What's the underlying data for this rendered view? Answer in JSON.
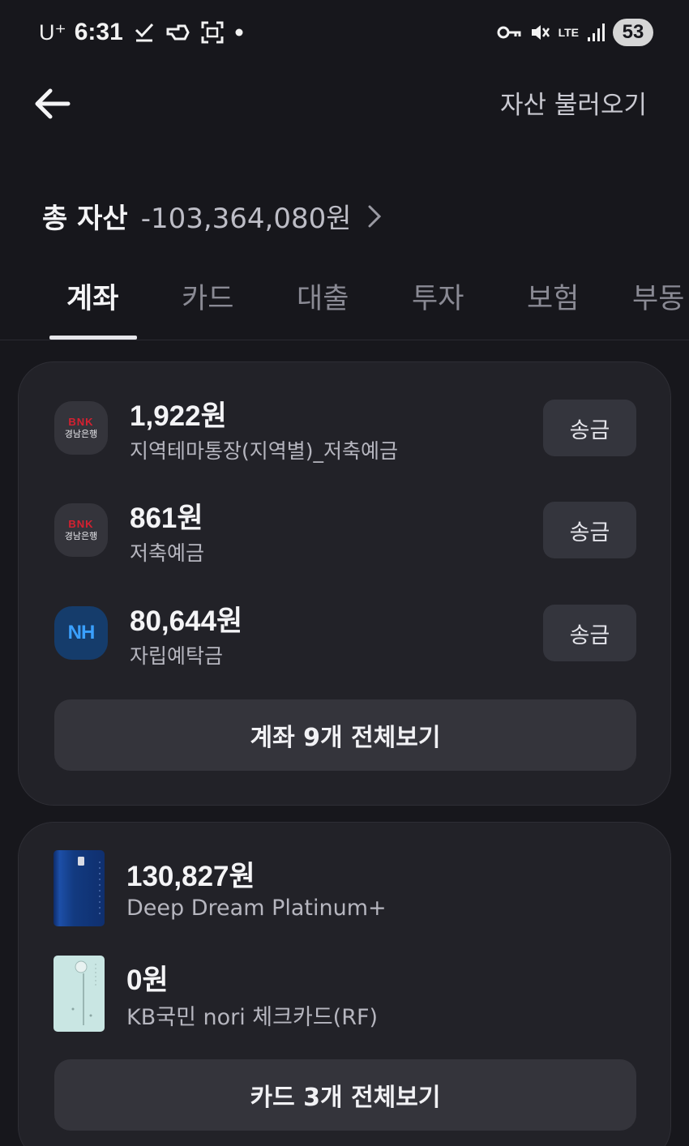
{
  "status_bar": {
    "carrier": "U⁺",
    "time": "6:31",
    "battery": "53",
    "network": "LTE"
  },
  "header": {
    "back_icon": "arrow-left-icon",
    "import_label": "자산 불러오기"
  },
  "total": {
    "label": "총 자산",
    "value": "-103,364,080원"
  },
  "tabs": [
    {
      "label": "계좌",
      "active": true
    },
    {
      "label": "카드",
      "active": false
    },
    {
      "label": "대출",
      "active": false
    },
    {
      "label": "투자",
      "active": false
    },
    {
      "label": "보험",
      "active": false
    },
    {
      "label": "부동",
      "active": false
    }
  ],
  "accounts": {
    "items": [
      {
        "logo": "BNK",
        "logo_sub": "경남은행",
        "amount": "1,922원",
        "name": "지역테마통장(지역별)_저축예금",
        "action": "송금"
      },
      {
        "logo": "BNK",
        "logo_sub": "경남은행",
        "amount": "861원",
        "name": "저축예금",
        "action": "송금"
      },
      {
        "logo": "NH",
        "amount": "80,644원",
        "name": "자립예탁금",
        "action": "송금"
      }
    ],
    "view_all": "계좌 9개 전체보기"
  },
  "cards": {
    "items": [
      {
        "amount": "130,827원",
        "name": "Deep Dream Platinum+"
      },
      {
        "amount": "0원",
        "name": "KB국민 nori 체크카드(RF)"
      }
    ],
    "view_all": "카드 3개 전체보기"
  },
  "colors": {
    "background": "#17171c",
    "panel": "#222228",
    "button": "#34343b",
    "bnk_red": "#d62030",
    "nh_blue": "#3aa0ff"
  }
}
